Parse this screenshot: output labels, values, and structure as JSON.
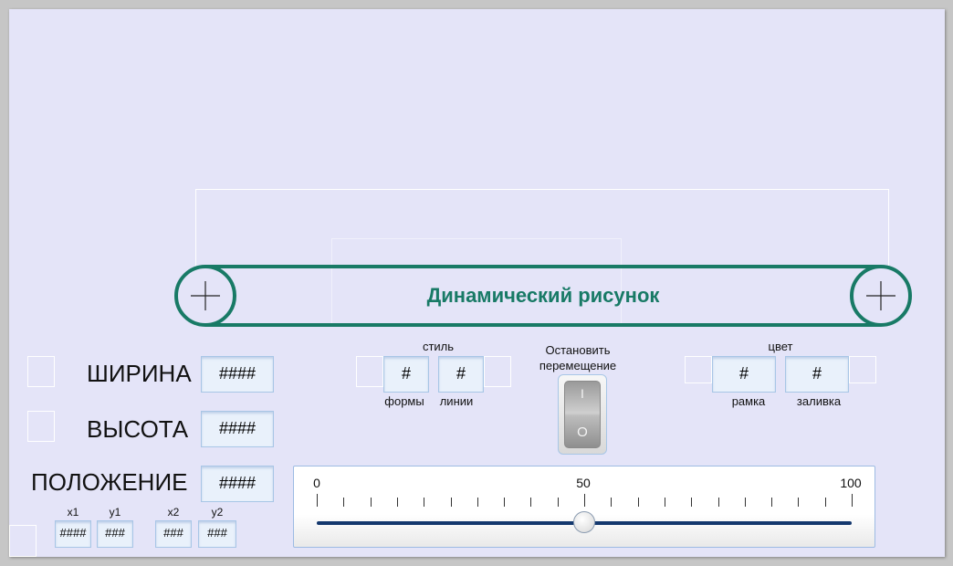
{
  "canvas": {
    "title": "Динамический рисунок",
    "accent_color": "#187a66"
  },
  "controls": {
    "width_label": "ШИРИНА",
    "width_value": "####",
    "height_label": "ВЫСОТА",
    "height_value": "####",
    "position_label": "ПОЛОЖЕНИЕ",
    "position_value": "####",
    "coords": [
      {
        "label": "x1",
        "value": "####"
      },
      {
        "label": "y1",
        "value": "###"
      },
      {
        "label": "x2",
        "value": "###"
      },
      {
        "label": "y2",
        "value": "###"
      }
    ]
  },
  "style_group": {
    "title": "стиль",
    "shape_value": "#",
    "shape_label": "формы",
    "line_value": "#",
    "line_label": "линии"
  },
  "toggle": {
    "label_line1": "Остановить",
    "label_line2": "перемещение",
    "on_symbol": "I",
    "off_symbol": "O"
  },
  "color_group": {
    "title": "цвет",
    "border_value": "#",
    "border_label": "рамка",
    "fill_value": "#",
    "fill_label": "заливка"
  },
  "slider": {
    "min_label": "0",
    "mid_label": "50",
    "max_label": "100",
    "value": 50,
    "track_color": "#14386e"
  }
}
